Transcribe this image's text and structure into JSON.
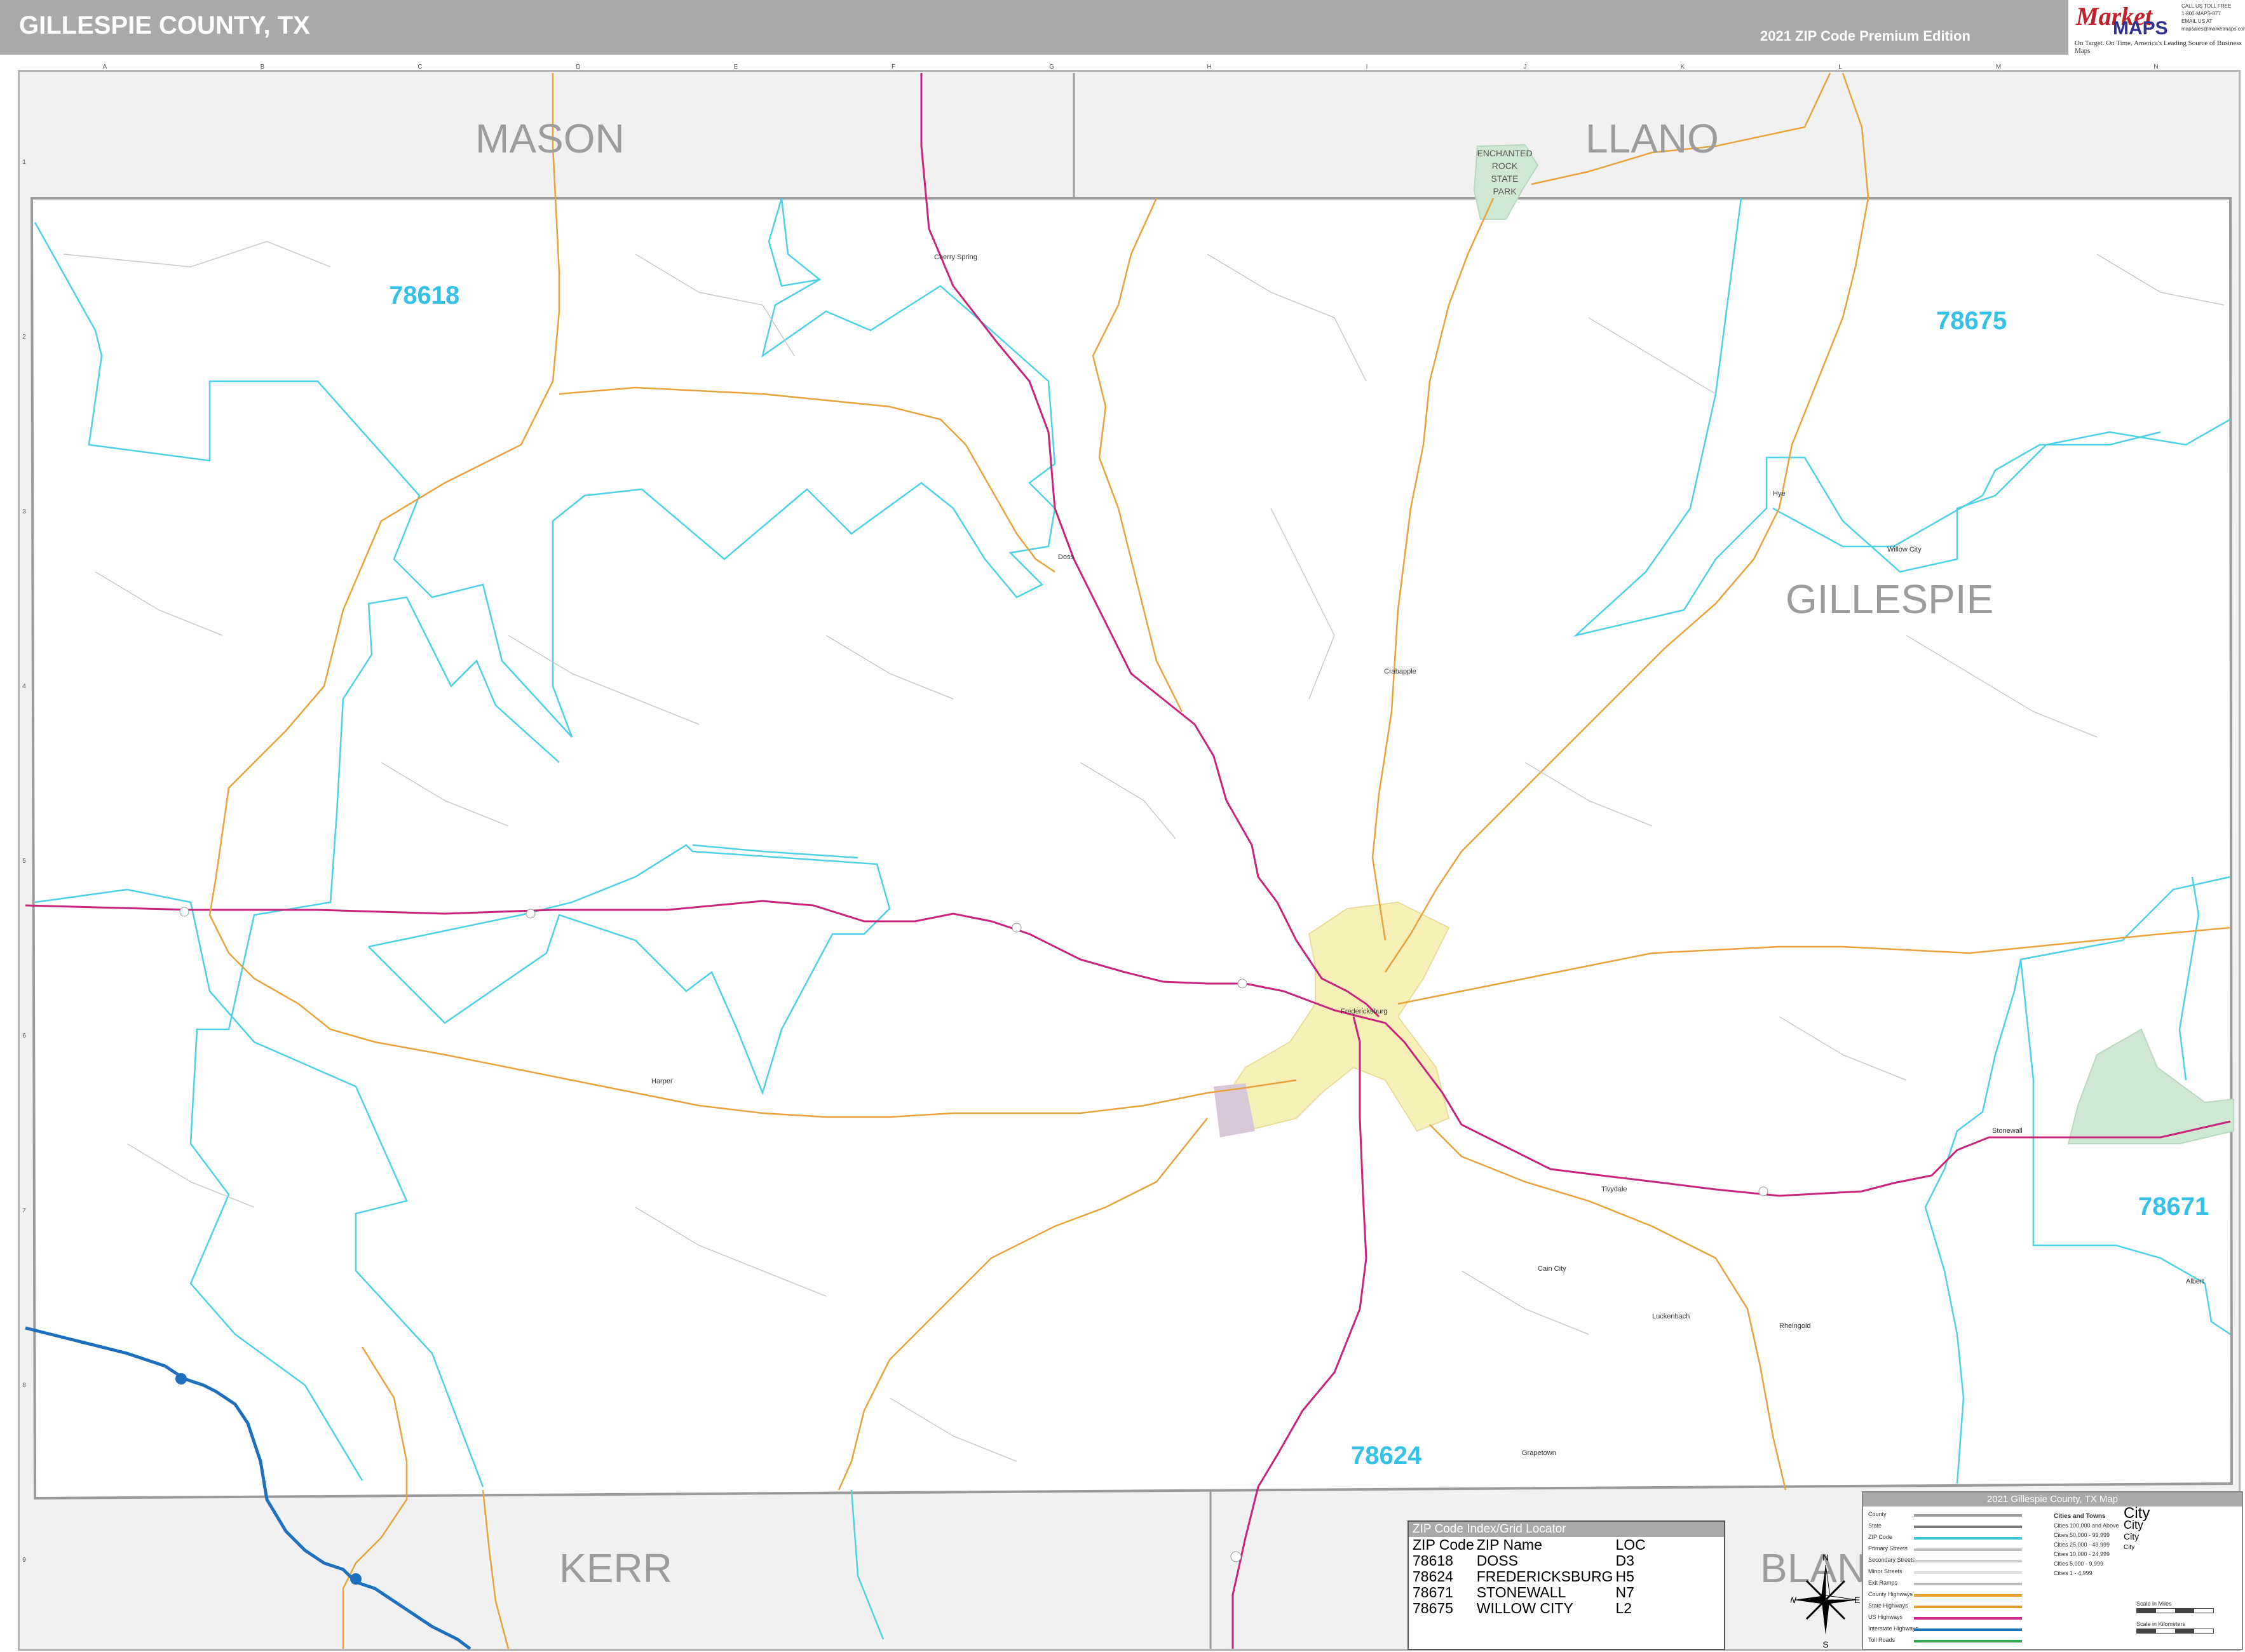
{
  "header": {
    "title": "GILLESPIE COUNTY, TX",
    "edition": "2021 ZIP Code Premium Edition"
  },
  "logo": {
    "brand_top": "Market",
    "brand_bottom": "MAPS",
    "tagline_1": "On Target. On Time.",
    "tagline_2": "America's Leading Source of Business Maps",
    "contact_lines": [
      "CALL US TOLL FREE",
      "1-800-MAPS-877",
      "EMAIL US AT",
      "mapsales@marketmaps.com"
    ]
  },
  "grid": {
    "columns": [
      "A",
      "B",
      "C",
      "D",
      "E",
      "F",
      "G",
      "H",
      "I",
      "J",
      "K",
      "L",
      "M",
      "N"
    ],
    "rows": [
      "1",
      "2",
      "3",
      "4",
      "5",
      "6",
      "7",
      "8",
      "9"
    ]
  },
  "county_labels": [
    "MASON",
    "LLANO",
    "GILLESPIE",
    "KERR",
    "BLANCO"
  ],
  "park_label": [
    "ENCHANTED",
    "ROCK",
    "STATE",
    "PARK"
  ],
  "zip_labels": [
    "78618",
    "78675",
    "78671",
    "78624"
  ],
  "places": [
    "Fredericksburg",
    "Harper",
    "Doss",
    "Cherry Spring",
    "Willow City",
    "Stonewall",
    "Luckenbach",
    "Albert",
    "Crabapple",
    "Cain City",
    "Grapetown",
    "Rheingold",
    "Hye",
    "Tivydale"
  ],
  "zip_index": {
    "title": "ZIP Code Index/Grid Locator",
    "columns": [
      "ZIP Code",
      "ZIP Name",
      "LOC"
    ],
    "rows": [
      [
        "78618",
        "DOSS",
        "D3"
      ],
      [
        "78624",
        "FREDERICKSBURG",
        "H5"
      ],
      [
        "78671",
        "STONEWALL",
        "N7"
      ],
      [
        "78675",
        "WILLOW CITY",
        "L2"
      ]
    ]
  },
  "compass": {
    "n": "N",
    "s": "S",
    "e": "E",
    "w": "W"
  },
  "legend": {
    "title": "2021 Gillespie County, TX Map",
    "line_items": [
      {
        "label": "County",
        "color": "#9a9a9a"
      },
      {
        "label": "State",
        "color": "#7a7a7a"
      },
      {
        "label": "ZIP Code",
        "color": "#39c6e0"
      },
      {
        "label": "Primary Streets",
        "color": "#bbbbbb"
      },
      {
        "label": "Secondary Streets",
        "color": "#cccccc"
      },
      {
        "label": "Minor Streets",
        "color": "#dddddd"
      },
      {
        "label": "Exit Ramps",
        "color": "#bbbbbb"
      },
      {
        "label": "County Highways",
        "color": "#f0a030"
      },
      {
        "label": "State Highways",
        "color": "#e39b2a"
      },
      {
        "label": "US Highways",
        "color": "#cc2d88"
      },
      {
        "label": "Interstate Highways",
        "color": "#1a6fb5"
      },
      {
        "label": "Toll Roads",
        "color": "#2fa84f"
      }
    ],
    "cities_header": "Cities and Towns",
    "city_sizes": [
      "Cities 100,000 and Above",
      "Cities 50,000 - 99,999",
      "Cities 25,000 - 49,999",
      "Cities 10,000 - 24,999",
      "Cities 5,000 - 9,999",
      "Cities 1 - 4,999"
    ],
    "city_demo": [
      "City",
      "City",
      "City",
      "City"
    ],
    "scale_miles": "Scale in Miles",
    "scale_km": "Scale in Kilometers"
  },
  "colors": {
    "zip_boundary": "#4dd0e6",
    "zip_label": "#35c0e8",
    "us_highway": "#c8247c",
    "state_highway": "#e8a23c",
    "interstate": "#1f6fbf",
    "park": "#cfe8d4",
    "urban": "#f7efb8",
    "county_label": "#9c9c9c"
  }
}
